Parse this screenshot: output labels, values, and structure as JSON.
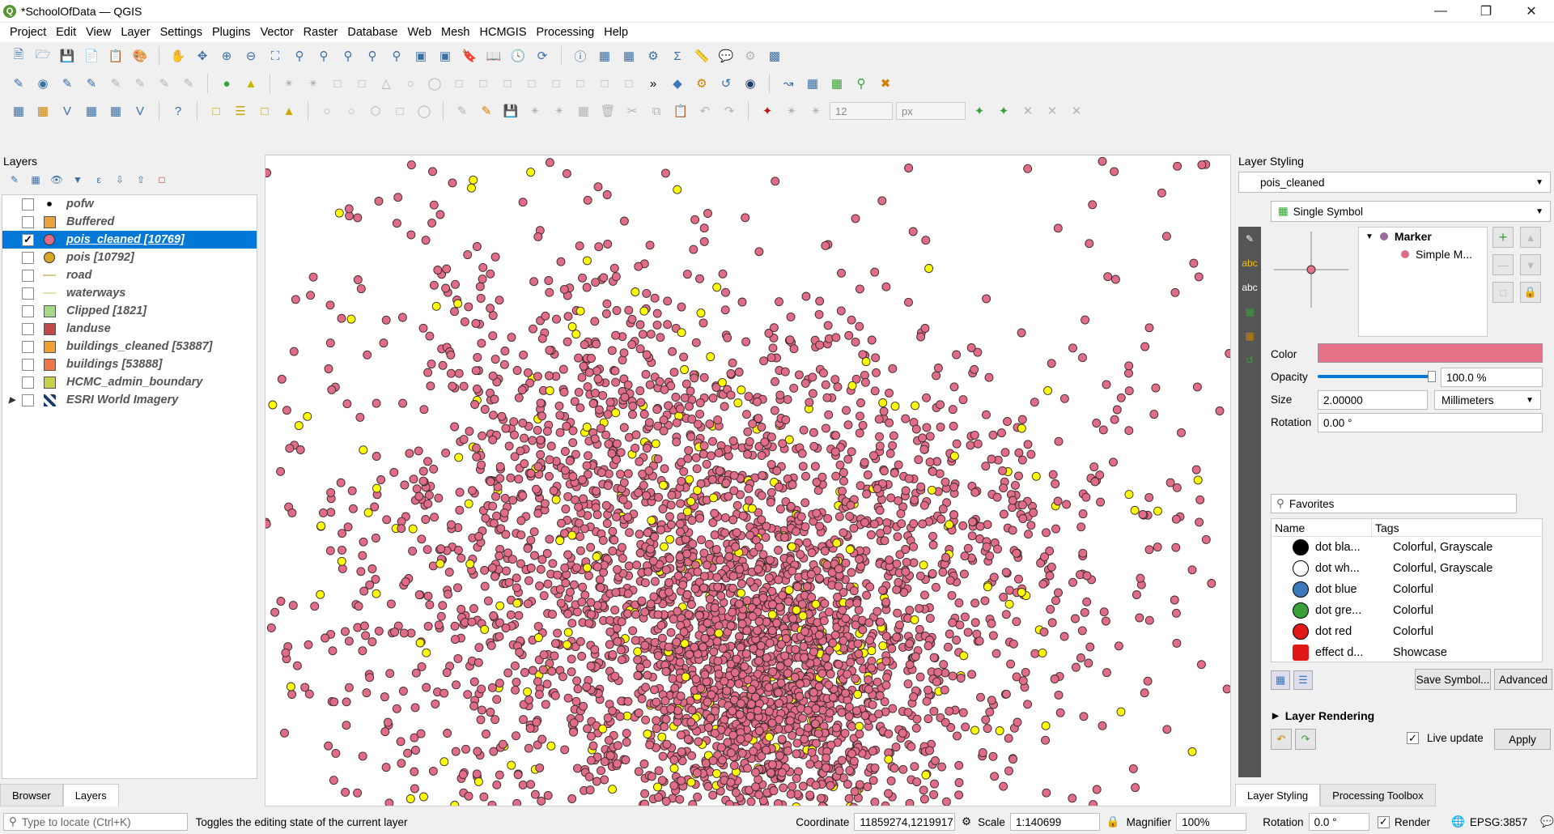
{
  "window": {
    "title": "*SchoolOfData — QGIS"
  },
  "menu": [
    "Project",
    "Edit",
    "View",
    "Layer",
    "Settings",
    "Plugins",
    "Vector",
    "Raster",
    "Database",
    "Web",
    "Mesh",
    "HCMGIS",
    "Processing",
    "Help"
  ],
  "toolbar": {
    "snap_size": "12",
    "snap_unit": "px"
  },
  "layers_panel": {
    "title": "Layers",
    "layers": [
      {
        "name": "pofw",
        "checked": false,
        "symbol": "dot-black",
        "color": "#000000"
      },
      {
        "name": "Buffered",
        "checked": false,
        "symbol": "square",
        "color": "#e8a33a"
      },
      {
        "name": "pois_cleaned [10769]",
        "checked": true,
        "symbol": "circle",
        "color": "#e06c87",
        "selected": true
      },
      {
        "name": "pois [10792]",
        "checked": false,
        "symbol": "circle",
        "color": "#d9a626"
      },
      {
        "name": "road",
        "checked": false,
        "symbol": "line",
        "color": "#d8c98f"
      },
      {
        "name": "waterways",
        "checked": false,
        "symbol": "line",
        "color": "#d8e6a8"
      },
      {
        "name": "Clipped [1821]",
        "checked": false,
        "symbol": "square",
        "color": "#a7d88a"
      },
      {
        "name": "landuse",
        "checked": false,
        "symbol": "square",
        "color": "#c04848"
      },
      {
        "name": "buildings_cleaned [53887]",
        "checked": false,
        "symbol": "square",
        "color": "#f0a030"
      },
      {
        "name": "buildings [53888]",
        "checked": false,
        "symbol": "square",
        "color": "#f0764a"
      },
      {
        "name": "HCMC_admin_boundary",
        "checked": false,
        "symbol": "square",
        "color": "#c8d04a"
      },
      {
        "name": "ESRI World Imagery",
        "checked": false,
        "symbol": "raster",
        "color": "#1a3a6a"
      }
    ],
    "tabs": [
      "Browser",
      "Layers"
    ]
  },
  "styling_panel": {
    "title": "Layer Styling",
    "layer": "pois_cleaned",
    "renderer": "Single Symbol",
    "tree_root": "Marker",
    "tree_child": "Simple M...",
    "color_label": "Color",
    "color_value": "#e8728a",
    "opacity_label": "Opacity",
    "opacity_value": "100.0 %",
    "opacity_fraction": 1.0,
    "size_label": "Size",
    "size_value": "2.00000",
    "size_unit": "Millimeters",
    "rotation_label": "Rotation",
    "rotation_value": "0.00 °",
    "library_filter": "Favorites",
    "library_headers": [
      "Name",
      "Tags"
    ],
    "library": [
      {
        "name": "dot bla...",
        "tags": "Colorful, Grayscale",
        "color": "#000000"
      },
      {
        "name": "dot wh...",
        "tags": "Colorful, Grayscale",
        "color": "#ffffff"
      },
      {
        "name": "dot blue",
        "tags": "Colorful",
        "color": "#3d78b8"
      },
      {
        "name": "dot gre...",
        "tags": "Colorful",
        "color": "#3aa13a"
      },
      {
        "name": "dot red",
        "tags": "Colorful",
        "color": "#e01818"
      },
      {
        "name": "effect d...",
        "tags": "Showcase",
        "color": "#e01818"
      }
    ],
    "save_symbol": "Save Symbol...",
    "advanced": "Advanced",
    "layer_rendering": "Layer Rendering",
    "live_update": "Live update",
    "apply": "Apply",
    "tabs": [
      "Layer Styling",
      "Processing Toolbox"
    ]
  },
  "status": {
    "locate_placeholder": "Type to locate (Ctrl+K)",
    "message": "Toggles the editing state of the current layer",
    "coordinate_label": "Coordinate",
    "coordinate": "11859274,1219917",
    "scale_label": "Scale",
    "scale": "1:140699",
    "magnifier_label": "Magnifier",
    "magnifier": "100%",
    "rotation_label": "Rotation",
    "rotation": "0.0 °",
    "render_label": "Render",
    "crs": "EPSG:3857"
  }
}
